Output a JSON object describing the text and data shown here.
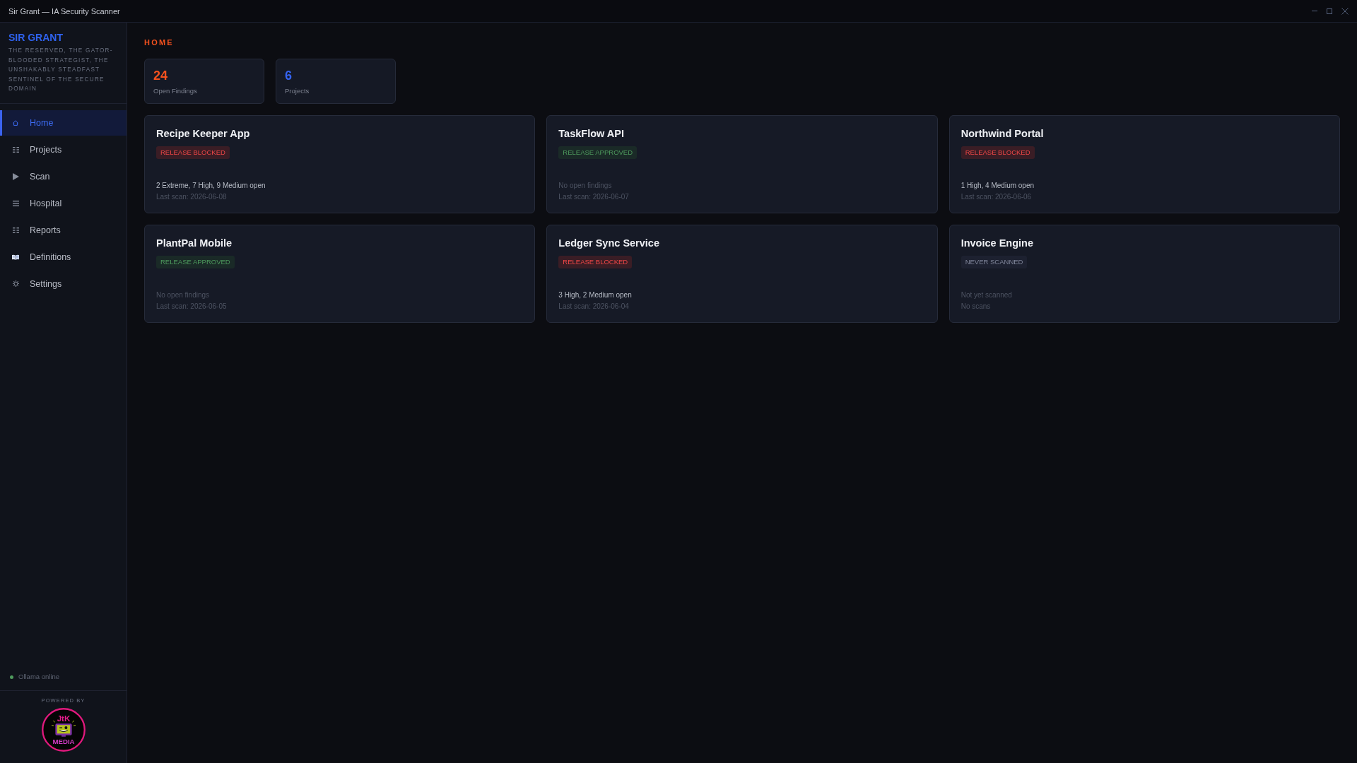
{
  "window": {
    "title": "Sir Grant — IA Security Scanner"
  },
  "sidebar": {
    "brand": "SIR GRANT",
    "tagline": "THE RESERVED, THE GATOR-BLOODED STRATEGIST, THE UNSHAKABLY STEADFAST SENTINEL OF THE SECURE DOMAIN",
    "items": [
      {
        "label": "Home",
        "selected": true
      },
      {
        "label": "Projects",
        "selected": false
      },
      {
        "label": "Scan",
        "selected": false
      },
      {
        "label": "Hospital",
        "selected": false
      },
      {
        "label": "Reports",
        "selected": false
      },
      {
        "label": "Definitions",
        "selected": false
      },
      {
        "label": "Settings",
        "selected": false
      }
    ],
    "status": {
      "label": "Ollama online",
      "online": true
    },
    "footer": {
      "caption": "POWERED BY",
      "logo": {
        "top": "JtK",
        "bottom": "MEDIA"
      }
    }
  },
  "page": {
    "heading": "HOME",
    "stats": [
      {
        "value": "24",
        "label": "Open Findings",
        "color": "#f4511e"
      },
      {
        "value": "6",
        "label": "Projects",
        "color": "#3563f0"
      }
    ],
    "projects": [
      {
        "name": "Recipe Keeper App",
        "status": {
          "label": "RELEASE BLOCKED",
          "kind": "blocked"
        },
        "summary": {
          "text": "2 Extreme, 7 High, 9 Medium open",
          "dimmed": false
        },
        "last_scan": "Last scan: 2026-06-08"
      },
      {
        "name": "TaskFlow API",
        "status": {
          "label": "RELEASE APPROVED",
          "kind": "approved"
        },
        "summary": {
          "text": "No open findings",
          "dimmed": true
        },
        "last_scan": "Last scan: 2026-06-07"
      },
      {
        "name": "Northwind Portal",
        "status": {
          "label": "RELEASE BLOCKED",
          "kind": "blocked"
        },
        "summary": {
          "text": "1 High, 4 Medium open",
          "dimmed": false
        },
        "last_scan": "Last scan: 2026-06-06"
      },
      {
        "name": "PlantPal Mobile",
        "status": {
          "label": "RELEASE APPROVED",
          "kind": "approved"
        },
        "summary": {
          "text": "No open findings",
          "dimmed": true
        },
        "last_scan": "Last scan: 2026-06-05"
      },
      {
        "name": "Ledger Sync Service",
        "status": {
          "label": "RELEASE BLOCKED",
          "kind": "blocked"
        },
        "summary": {
          "text": "3 High, 2 Medium open",
          "dimmed": false
        },
        "last_scan": "Last scan: 2026-06-04"
      },
      {
        "name": "Invoice Engine",
        "status": {
          "label": "NEVER SCANNED",
          "kind": "never"
        },
        "summary": {
          "text": "Not yet scanned",
          "dimmed": true
        },
        "last_scan": "No scans"
      }
    ]
  }
}
